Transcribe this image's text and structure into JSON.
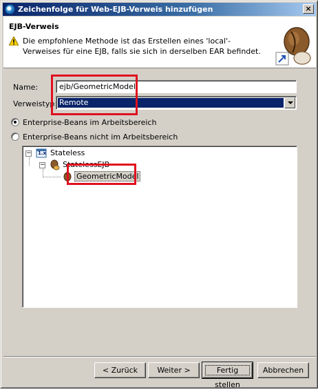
{
  "window": {
    "title": "Zeichenfolge für Web-EJB-Verweis hinzufügen",
    "close_label": "×"
  },
  "header": {
    "title": "EJB-Verweis",
    "message": "Die empfohlene Methode ist das Erstellen eines 'local'-Verweises für eine EJB, falls sie sich in derselben EAR befindet."
  },
  "form": {
    "name_label": "Name:",
    "name_value": "ejb/GeometricModel",
    "type_label": "Verweistyp:",
    "type_value": "Remote"
  },
  "options": {
    "workspace_label": "Enterprise-Beans im Arbeitsbereich",
    "not_workspace_label": "Enterprise-Beans nicht im Arbeitsbereich",
    "selected": "workspace"
  },
  "tree": {
    "root_label": "Stateless",
    "root_badge": "1.x",
    "child_label": "StatelessEJB",
    "leaf_label": "GeometricModel"
  },
  "buttons": {
    "back": "< Zurück",
    "next": "Weiter >",
    "finish": "Fertig stellen",
    "cancel": "Abbrechen"
  },
  "colors": {
    "highlight_annotation": "#e0101e",
    "selection": "#0a246a",
    "dialog_bg": "#d4d0c8"
  }
}
